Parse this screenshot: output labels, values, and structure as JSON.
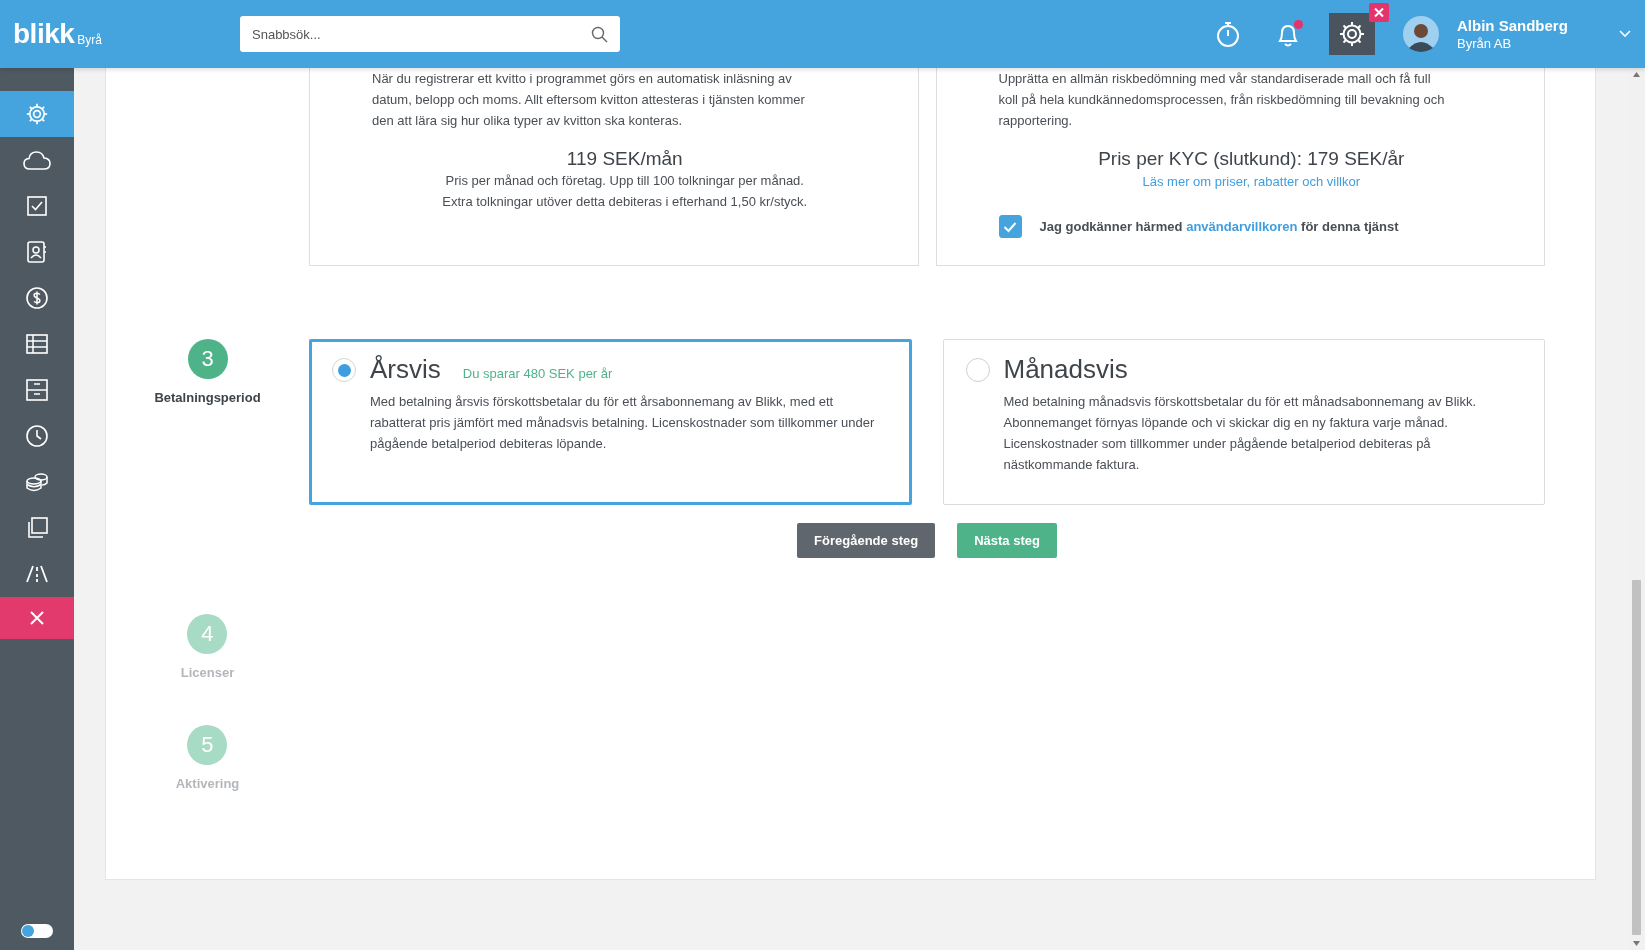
{
  "header": {
    "logo": "blikk",
    "logo_suffix": "Byrå",
    "search": {
      "placeholder": "Snabbsök..."
    },
    "notification_unread": true,
    "user": {
      "name": "Albin Sandberg",
      "company": "Byrån AB"
    }
  },
  "sidebar": {
    "items": [
      {
        "kind": "settings",
        "selected": true
      },
      {
        "kind": "cloud",
        "selected": false
      },
      {
        "kind": "task",
        "selected": false
      },
      {
        "kind": "contacts",
        "selected": false
      },
      {
        "kind": "money",
        "selected": false
      },
      {
        "kind": "table",
        "selected": false
      },
      {
        "kind": "archive",
        "selected": false
      },
      {
        "kind": "clock",
        "selected": false
      },
      {
        "kind": "coins",
        "selected": false
      },
      {
        "kind": "copy",
        "selected": false
      },
      {
        "kind": "road",
        "selected": false
      },
      {
        "kind": "close",
        "selected": false
      }
    ],
    "toggle": {
      "on": false
    }
  },
  "services": [
    {
      "description": "När du registrerar ett kvitto i programmet görs en automatisk inläsning av datum, belopp och moms. Allt eftersom kvitton attesteras i tjänsten kommer den att lära sig hur olika typer av kvitton ska konteras.",
      "price": "119 SEK/mån",
      "notes": [
        "Pris per månad och företag. Upp till 100 tolkningar per månad.",
        "Extra tolkningar utöver detta debiteras i efterhand 1,50 kr/styck."
      ]
    },
    {
      "description": "Upprätta en allmän riskbedömning med vår standardiserade mall och få full koll på hela kundkännedomsprocessen, från riskbedömning till bevakning och rapportering.",
      "price": "Pris per KYC (slutkund): 179 SEK/år",
      "link": "Läs mer om priser, rabatter och villkor",
      "terms": {
        "checked": true,
        "before": "Jag godkänner härmed",
        "link": "användarvillkoren",
        "after": "för denna tjänst"
      }
    }
  ],
  "steps": [
    {
      "number": "3",
      "label": "Betalningsperiod",
      "active": true
    },
    {
      "number": "4",
      "label": "Licenser",
      "active": false
    },
    {
      "number": "5",
      "label": "Aktivering",
      "active": false
    }
  ],
  "payment_options": [
    {
      "title": "Årsvis",
      "savings": "Du sparar 480 SEK per år",
      "description": "Med betalning årsvis förskottsbetalar du för ett årsabonnemang av Blikk, med ett rabatterat pris jämfört med månadsvis betalning. Licenskostnader som tillkommer under pågående betalperiod debiteras löpande.",
      "selected": true
    },
    {
      "title": "Månadsvis",
      "description": "Med betalning månadsvis förskottsbetalar du för ett månadsabonnemang av Blikk. Abonnemanget förnyas löpande och vi skickar dig en ny faktura varje månad. Licenskostnader som tillkommer under pågående betalperiod debiteras på nästkommande faktura.",
      "selected": false
    }
  ],
  "buttons": {
    "previous": "Föregående steg",
    "next": "Nästa steg"
  }
}
